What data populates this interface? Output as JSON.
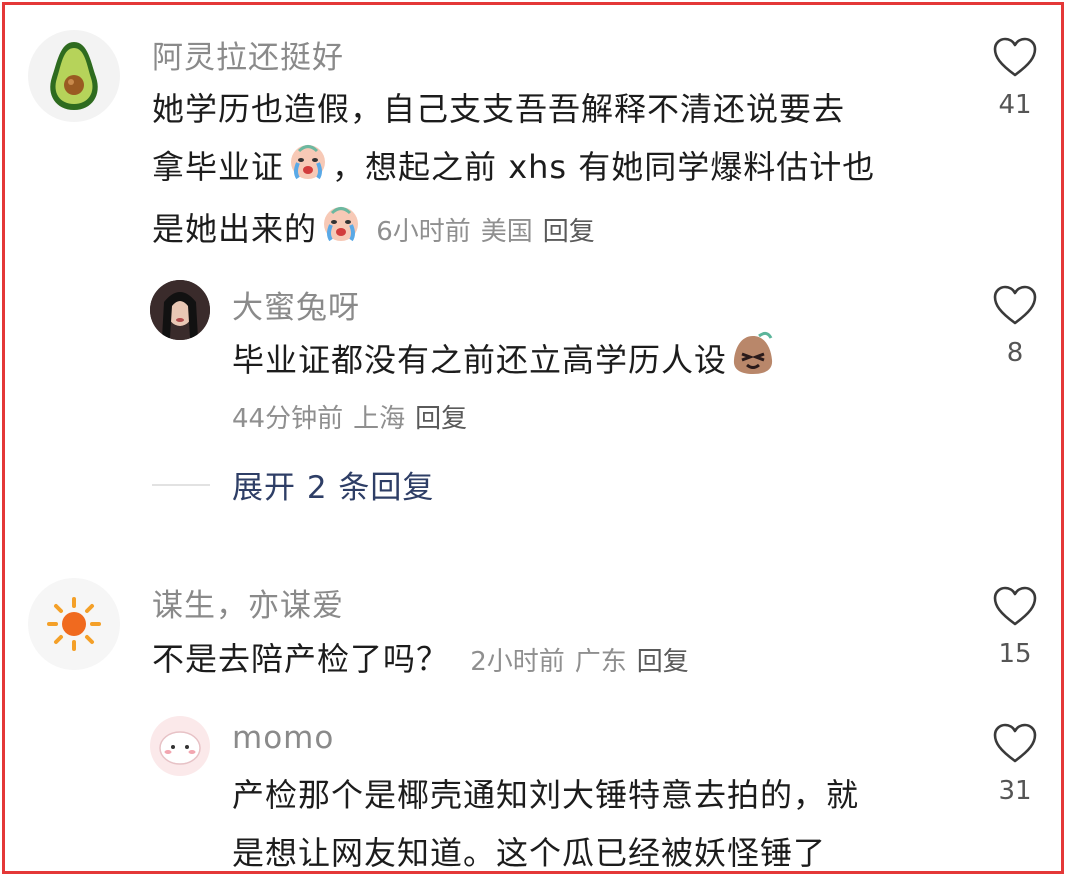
{
  "comments": [
    {
      "username": "阿灵拉还挺好",
      "line1": "她学历也造假，自己支支吾吾解释不清还说要去",
      "line2a": "拿毕业证",
      "line2b": "，想起之前 xhs 有她同学爆料估计也",
      "line3": "是她出来的",
      "time": "6小时前",
      "location": "美国",
      "reply": "回复",
      "likes": "41",
      "avatar_icon": "avocado-icon",
      "emoji": "crying-face-icon"
    },
    {
      "username": "大蜜兔呀",
      "text": "毕业证都没有之前还立高学历人设",
      "time": "44分钟前",
      "location": "上海",
      "reply": "回复",
      "likes": "8",
      "emoji": "smug-face-icon"
    },
    {
      "username": "谋生，亦谋爱",
      "text": "不是去陪产检了吗？",
      "time": "2小时前",
      "location": "广东",
      "reply": "回复",
      "likes": "15",
      "avatar_icon": "sun-icon"
    },
    {
      "username": "momo",
      "line1": "产检那个是椰壳通知刘大锤特意去拍的，就",
      "line2": "是想让网友知道。这个瓜已经被妖怪锤了",
      "likes": "31"
    }
  ],
  "expand_replies": "展开 2 条回复",
  "colors": {
    "border": "#e43838",
    "expand_text": "#2e3e66"
  }
}
